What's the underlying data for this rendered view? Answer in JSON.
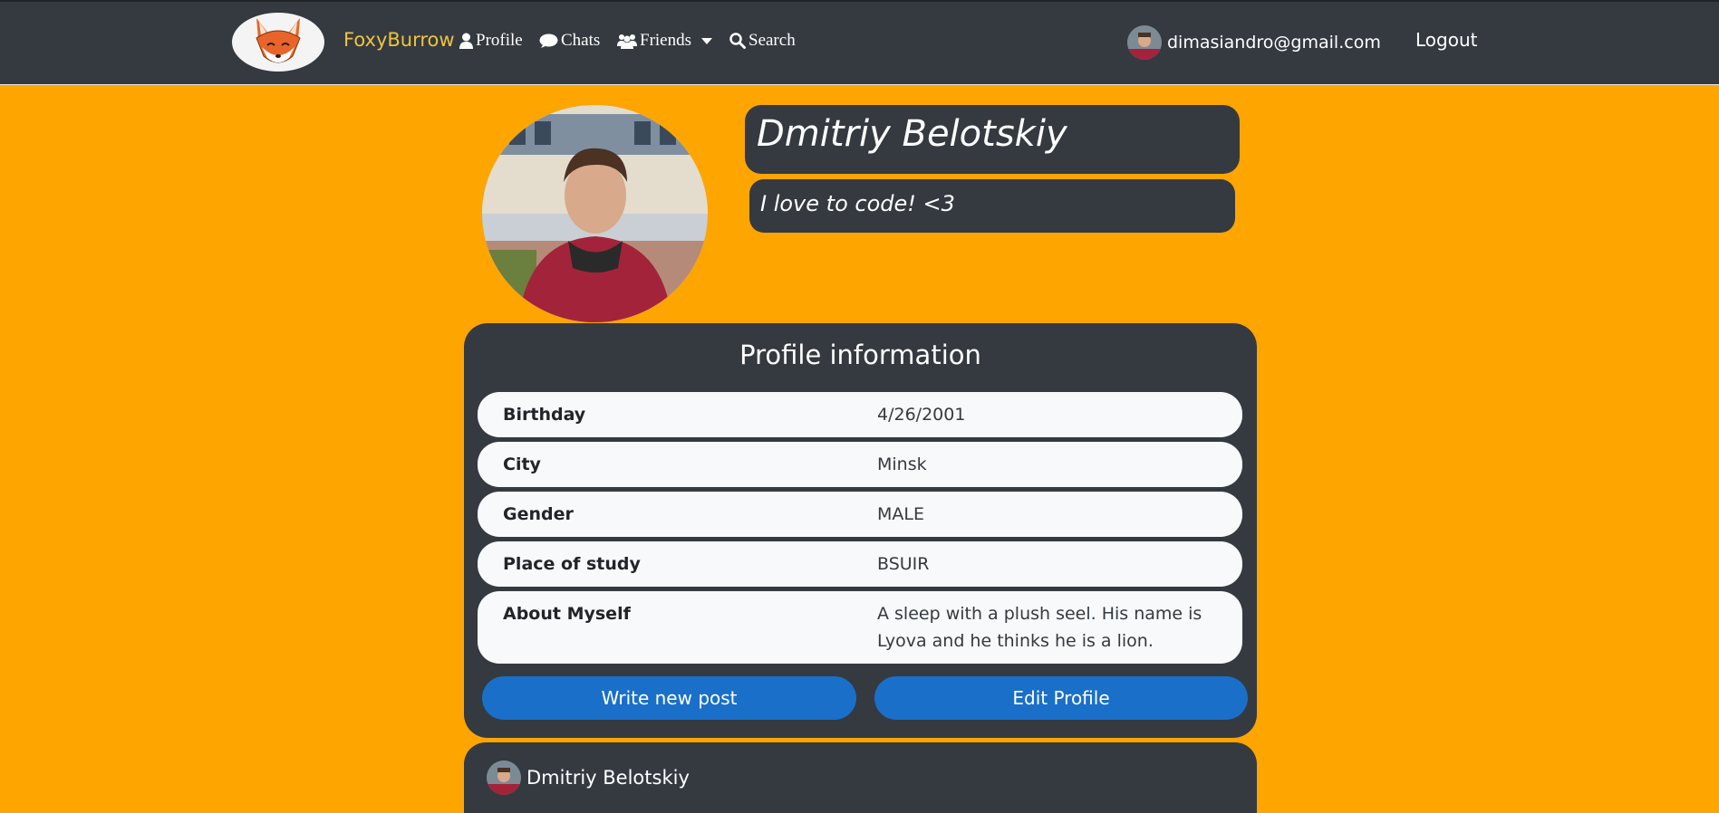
{
  "navbar": {
    "brand": "FoxyBurrow",
    "links": {
      "profile": "Profile",
      "chats": "Chats",
      "friends": "Friends",
      "search": "Search"
    },
    "user_email": "dimasiandro@gmail.com",
    "logout": "Logout"
  },
  "profile": {
    "name": "Dmitriy Belotskiy",
    "status": "I love to code! <3"
  },
  "info": {
    "title": "Profile information",
    "rows": [
      {
        "label": "Birthday",
        "value": "4/26/2001"
      },
      {
        "label": "City",
        "value": "Minsk"
      },
      {
        "label": "Gender",
        "value": "MALE"
      },
      {
        "label": "Place of study",
        "value": "BSUIR"
      },
      {
        "label": "About Myself",
        "value": "A sleep with a plush seel. His name is Lyova and he thinks he is a lion."
      }
    ],
    "write_post": "Write new post",
    "edit_profile": "Edit Profile"
  },
  "post": {
    "author": "Dmitriy Belotskiy"
  },
  "colors": {
    "background": "#ffa500",
    "panel": "#343a40",
    "brand": "#f0c43c",
    "button": "#1a6fc9"
  }
}
